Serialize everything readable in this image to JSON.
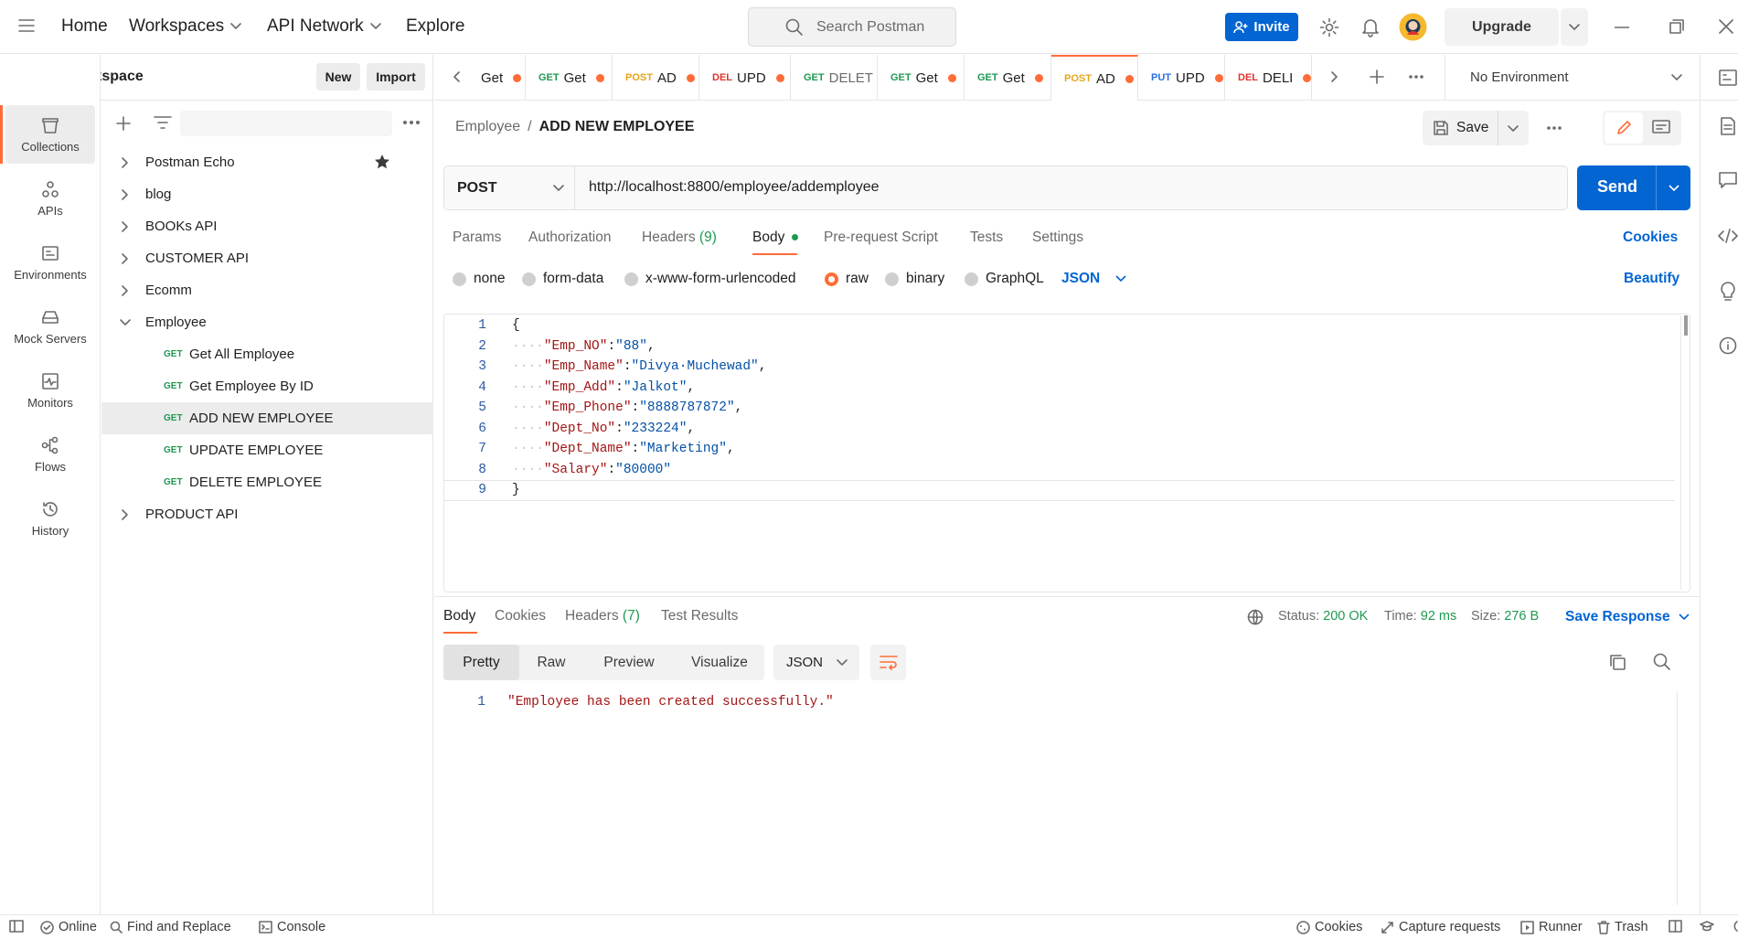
{
  "topbar": {
    "home": "Home",
    "workspaces": "Workspaces",
    "api_network": "API Network",
    "explore": "Explore",
    "search_placeholder": "Search Postman",
    "invite": "Invite",
    "upgrade": "Upgrade"
  },
  "rail": {
    "collections": "Collections",
    "apis": "APIs",
    "environments": "Environments",
    "mock_servers": "Mock Servers",
    "monitors": "Monitors",
    "flows": "Flows",
    "history": "History"
  },
  "sidebar": {
    "workspace": "My Workspace",
    "new": "New",
    "import": "Import",
    "items": [
      {
        "label": "Postman Echo"
      },
      {
        "label": "blog"
      },
      {
        "label": "BOOKs API"
      },
      {
        "label": "CUSTOMER API"
      },
      {
        "label": "Ecomm"
      },
      {
        "label": "Employee"
      },
      {
        "method": "GET",
        "label": "Get All Employee"
      },
      {
        "method": "GET",
        "label": "Get Employee By ID"
      },
      {
        "method": "GET",
        "label": "ADD NEW EMPLOYEE"
      },
      {
        "method": "GET",
        "label": "UPDATE EMPLOYEE"
      },
      {
        "method": "GET",
        "label": "DELETE EMPLOYEE"
      },
      {
        "label": "PRODUCT API"
      }
    ]
  },
  "tabs": [
    {
      "method": "",
      "label": "Get"
    },
    {
      "method": "GET",
      "label": "Get"
    },
    {
      "method": "POST",
      "label": "AD"
    },
    {
      "method": "DEL",
      "label": "UPD"
    },
    {
      "method": "GET",
      "label": "DELET"
    },
    {
      "method": "GET",
      "label": "Get"
    },
    {
      "method": "GET",
      "label": "Get"
    },
    {
      "method": "POST",
      "label": "AD"
    },
    {
      "method": "PUT",
      "label": "UPD"
    },
    {
      "method": "DEL",
      "label": "DELI"
    }
  ],
  "environment": "No Environment",
  "request": {
    "breadcrumb_parent": "Employee",
    "breadcrumb_sep": "/",
    "breadcrumb_current": "ADD NEW EMPLOYEE",
    "save": "Save",
    "method": "POST",
    "url": "http://localhost:8800/employee/addemployee",
    "send": "Send",
    "tabs": {
      "params": "Params",
      "authorization": "Authorization",
      "headers": "Headers",
      "headers_count": "(9)",
      "body": "Body",
      "pre_request": "Pre-request Script",
      "tests": "Tests",
      "settings": "Settings",
      "cookies": "Cookies"
    },
    "body_types": {
      "none": "none",
      "form_data": "form-data",
      "urlencoded": "x-www-form-urlencoded",
      "raw": "raw",
      "binary": "binary",
      "graphql": "GraphQL",
      "json": "JSON",
      "beautify": "Beautify"
    },
    "body_lines": [
      {
        "n": "1",
        "open": "{"
      },
      {
        "n": "2",
        "key": "\"Emp_NO\"",
        "val": "\"88\"",
        "comma": ","
      },
      {
        "n": "3",
        "key": "\"Emp_Name\"",
        "val": "\"Divya·Muchewad\"",
        "comma": ","
      },
      {
        "n": "4",
        "key": "\"Emp_Add\"",
        "val": "\"Jalkot\"",
        "comma": ","
      },
      {
        "n": "5",
        "key": "\"Emp_Phone\"",
        "val": "\"8888787872\"",
        "comma": ","
      },
      {
        "n": "6",
        "key": "\"Dept_No\"",
        "val": "\"233224\"",
        "comma": ","
      },
      {
        "n": "7",
        "key": "\"Dept_Name\"",
        "val": "\"Marketing\"",
        "comma": ","
      },
      {
        "n": "8",
        "key": "\"Salary\"",
        "val": "\"80000\"",
        "comma": ""
      },
      {
        "n": "9",
        "open": "}"
      }
    ]
  },
  "response": {
    "tabs": {
      "body": "Body",
      "cookies": "Cookies",
      "headers": "Headers",
      "headers_count": "(7)",
      "test_results": "Test Results"
    },
    "status_label": "Status:",
    "status_value": "200 OK",
    "time_label": "Time:",
    "time_value": "92 ms",
    "size_label": "Size:",
    "size_value": "276 B",
    "save_response": "Save Response",
    "views": {
      "pretty": "Pretty",
      "raw": "Raw",
      "preview": "Preview",
      "visualize": "Visualize",
      "format": "JSON"
    },
    "line_no": "1",
    "body": "\"Employee has been created successfully.\""
  },
  "statusbar": {
    "online": "Online",
    "find_replace": "Find and Replace",
    "console": "Console",
    "cookies": "Cookies",
    "capture": "Capture requests",
    "runner": "Runner",
    "trash": "Trash"
  }
}
